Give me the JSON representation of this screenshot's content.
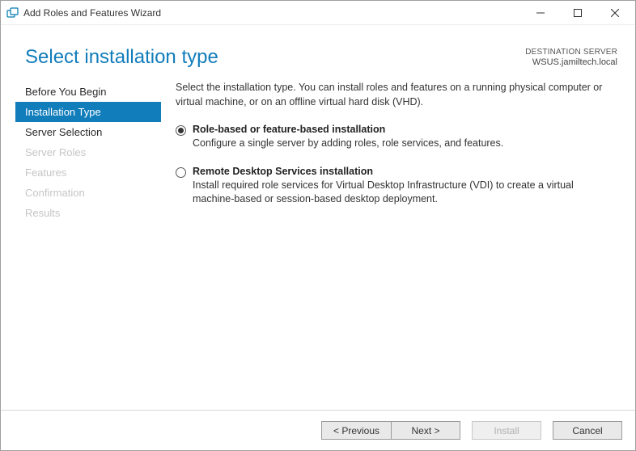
{
  "titlebar": {
    "title": "Add Roles and Features Wizard"
  },
  "header": {
    "heading": "Select installation type",
    "destination_label": "DESTINATION SERVER",
    "destination_value": "WSUS.jamiltech.local"
  },
  "sidebar": {
    "items": [
      {
        "label": "Before You Begin",
        "state": "enabled"
      },
      {
        "label": "Installation Type",
        "state": "active"
      },
      {
        "label": "Server Selection",
        "state": "enabled"
      },
      {
        "label": "Server Roles",
        "state": "disabled"
      },
      {
        "label": "Features",
        "state": "disabled"
      },
      {
        "label": "Confirmation",
        "state": "disabled"
      },
      {
        "label": "Results",
        "state": "disabled"
      }
    ]
  },
  "content": {
    "intro": "Select the installation type. You can install roles and features on a running physical computer or virtual machine, or on an offline virtual hard disk (VHD).",
    "options": [
      {
        "title": "Role-based or feature-based installation",
        "desc": "Configure a single server by adding roles, role services, and features.",
        "checked": true
      },
      {
        "title": "Remote Desktop Services installation",
        "desc": "Install required role services for Virtual Desktop Infrastructure (VDI) to create a virtual machine-based or session-based desktop deployment.",
        "checked": false
      }
    ]
  },
  "footer": {
    "previous": "< Previous",
    "next": "Next >",
    "install": "Install",
    "cancel": "Cancel"
  }
}
